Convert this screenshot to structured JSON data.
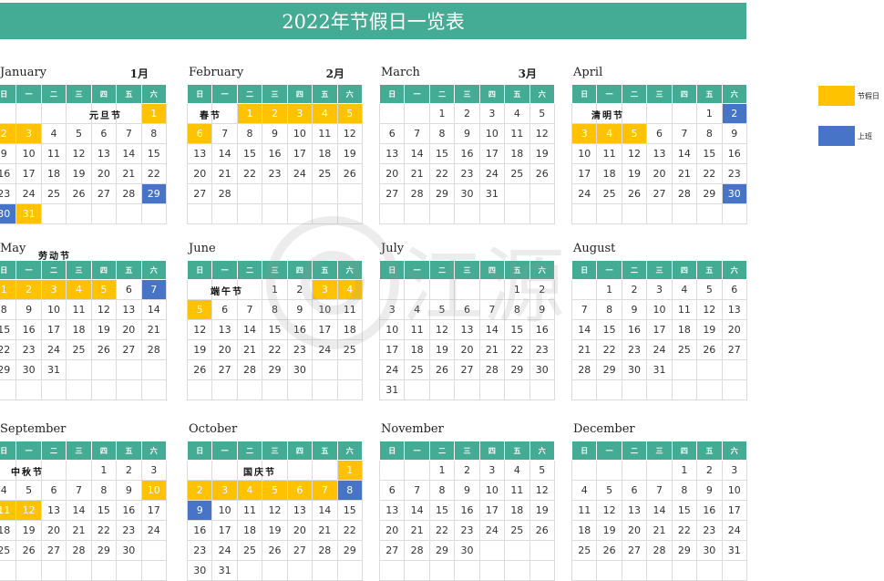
{
  "title": "2022年节假日一览表",
  "weekdays": [
    "日",
    "一",
    "二",
    "三",
    "四",
    "五",
    "六"
  ],
  "legend": [
    {
      "label": "节假日",
      "color": "#fec200"
    },
    {
      "label": "上班",
      "color": "#4774c6"
    }
  ],
  "watermark_text": "江源",
  "months": [
    {
      "name": "January",
      "cn": "1月",
      "first": 6,
      "days": 31,
      "holiday": [
        1,
        2,
        3,
        31
      ],
      "work": [
        29,
        30
      ],
      "festival": "元旦节"
    },
    {
      "name": "February",
      "cn": "2月",
      "first": 2,
      "days": 28,
      "holiday": [
        1,
        2,
        3,
        4,
        5,
        6
      ],
      "work": [],
      "festival": "春节"
    },
    {
      "name": "March",
      "cn": "3月",
      "first": 2,
      "days": 31,
      "holiday": [],
      "work": [],
      "festival": ""
    },
    {
      "name": "April",
      "cn": "",
      "first": 5,
      "days": 30,
      "holiday": [
        3,
        4,
        5
      ],
      "work": [
        2,
        30
      ],
      "festival": "清明节"
    },
    {
      "name": "May",
      "cn": "",
      "first": 0,
      "days": 31,
      "holiday": [
        1,
        2,
        3,
        4,
        5
      ],
      "work": [
        7
      ],
      "festival": "劳动节"
    },
    {
      "name": "June",
      "cn": "",
      "first": 3,
      "days": 30,
      "holiday": [
        3,
        4,
        5
      ],
      "work": [],
      "festival": "端午节"
    },
    {
      "name": "July",
      "cn": "",
      "first": 5,
      "days": 31,
      "holiday": [],
      "work": [],
      "festival": ""
    },
    {
      "name": "August",
      "cn": "",
      "first": 1,
      "days": 31,
      "holiday": [],
      "work": [],
      "festival": ""
    },
    {
      "name": "September",
      "cn": "",
      "first": 4,
      "days": 30,
      "holiday": [
        10,
        11,
        12
      ],
      "work": [],
      "festival": "中秋节"
    },
    {
      "name": "October",
      "cn": "",
      "first": 6,
      "days": 31,
      "holiday": [
        1,
        2,
        3,
        4,
        5,
        6,
        7
      ],
      "work": [
        8,
        9
      ],
      "festival": "国庆节"
    },
    {
      "name": "November",
      "cn": "",
      "first": 2,
      "days": 30,
      "holiday": [],
      "work": [],
      "festival": ""
    },
    {
      "name": "December",
      "cn": "",
      "first": 4,
      "days": 31,
      "holiday": [],
      "work": [],
      "festival": ""
    }
  ]
}
